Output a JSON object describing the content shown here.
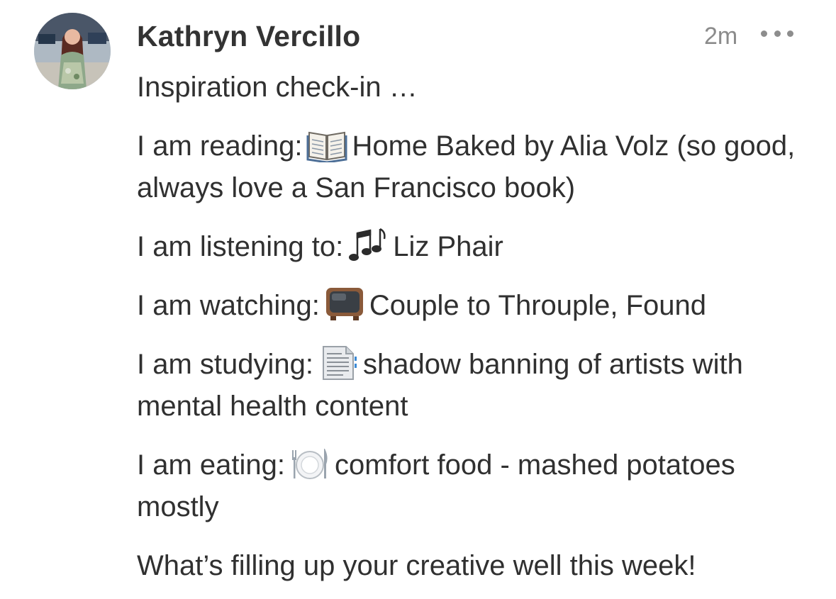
{
  "post": {
    "author": "Kathryn Vercillo",
    "timestamp": "2m",
    "intro": "Inspiration check-in …",
    "lines": [
      {
        "label": "I am reading:",
        "icon": "open-book-icon",
        "text": "Home Baked by Alia Volz (so good, always love a San Francisco book)"
      },
      {
        "label": "I am listening to:",
        "icon": "music-notes-icon",
        "text": "Liz Phair"
      },
      {
        "label": "I am watching:",
        "icon": "television-icon",
        "text": "Couple to Throuple, Found"
      },
      {
        "label": "I am studying:",
        "icon": "document-icon",
        "text": "shadow banning of artists with mental health content"
      },
      {
        "label": "I am eating:",
        "icon": "plate-cutlery-icon",
        "text": "comfort food - mashed potatoes mostly"
      }
    ],
    "closing": "What’s filling up your creative well this week!"
  }
}
